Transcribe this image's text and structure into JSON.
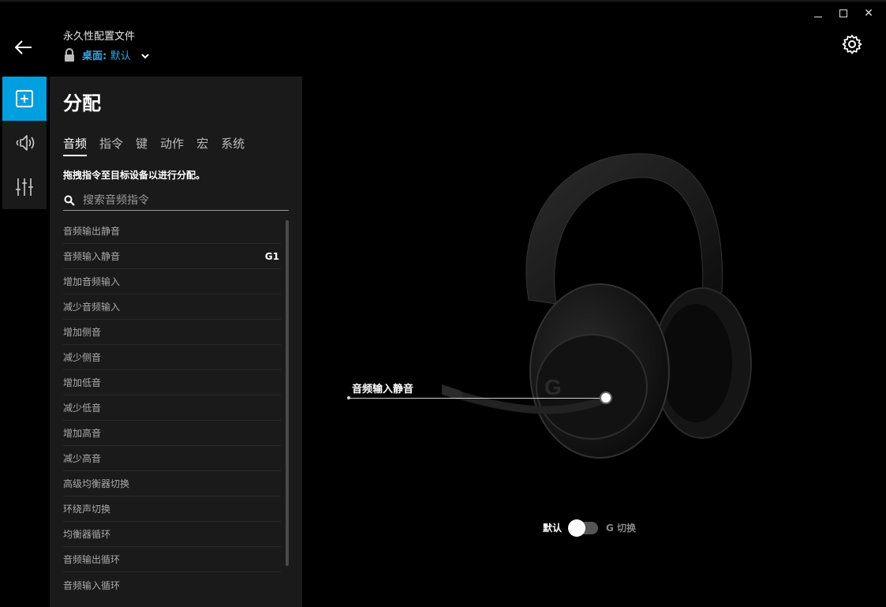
{
  "window": {
    "min_icon": "minimize-icon",
    "max_icon": "maximize-icon",
    "close_icon": "close-icon",
    "close_glyph": "✕"
  },
  "header": {
    "profile_title": "永久性配置文件",
    "profile_prefix": "桌面: ",
    "profile_value": "默认",
    "back_icon": "arrow-left-icon",
    "lock_icon": "lock-icon",
    "gear_icon": "gear-icon"
  },
  "rail": {
    "items": [
      {
        "icon": "plus-square-icon",
        "active": true
      },
      {
        "icon": "speaker-icon",
        "active": false
      },
      {
        "icon": "equalizer-icon",
        "active": false
      }
    ],
    "accent_color": "#00a0e0"
  },
  "panel": {
    "title": "分配",
    "tabs": [
      "音频",
      "指令",
      "键",
      "动作",
      "宏",
      "系统"
    ],
    "active_tab": "音频",
    "hint": "拖拽指令至目标设备以进行分配。",
    "search_placeholder": "搜索音频指令",
    "items": [
      {
        "label": "音频输出静音",
        "key": ""
      },
      {
        "label": "音频输入静音",
        "key": "G1"
      },
      {
        "label": "增加音频输入",
        "key": ""
      },
      {
        "label": "减少音频输入",
        "key": ""
      },
      {
        "label": "增加侧音",
        "key": ""
      },
      {
        "label": "减少侧音",
        "key": ""
      },
      {
        "label": "增加低音",
        "key": ""
      },
      {
        "label": "减少低音",
        "key": ""
      },
      {
        "label": "增加高音",
        "key": ""
      },
      {
        "label": "减少高音",
        "key": ""
      },
      {
        "label": "高级均衡器切换",
        "key": ""
      },
      {
        "label": "环绕声切换",
        "key": ""
      },
      {
        "label": "均衡器循环",
        "key": ""
      },
      {
        "label": "音频输出循环",
        "key": ""
      },
      {
        "label": "音频输入循环",
        "key": ""
      }
    ]
  },
  "device": {
    "callout_label": "音频输入静音"
  },
  "toggle": {
    "left_label": "默认",
    "right_label": "G 切换",
    "state": "off"
  }
}
